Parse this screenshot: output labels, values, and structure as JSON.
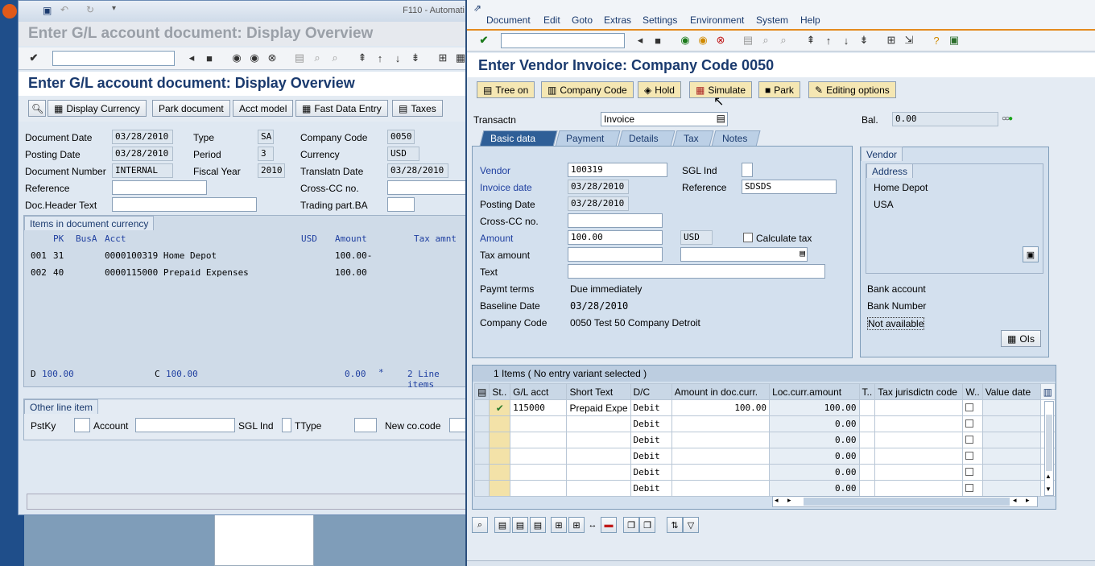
{
  "left_window": {
    "window_title": "F110 - Automati",
    "title": "Enter G/L account document: Display Overview",
    "header_title": "Enter G/L account document: Display Overview",
    "buttons": {
      "display_currency": "Display Currency",
      "park_document": "Park document",
      "acct_model": "Acct model",
      "fast_data_entry": "Fast Data Entry",
      "taxes": "Taxes"
    },
    "fields": {
      "document_date": {
        "label": "Document Date",
        "value": "03/28/2010"
      },
      "posting_date": {
        "label": "Posting Date",
        "value": "03/28/2010"
      },
      "document_number": {
        "label": "Document Number",
        "value": "INTERNAL"
      },
      "reference": {
        "label": "Reference",
        "value": ""
      },
      "doc_header_text": {
        "label": "Doc.Header Text",
        "value": ""
      },
      "type": {
        "label": "Type",
        "value": "SA"
      },
      "period": {
        "label": "Period",
        "value": "3"
      },
      "fiscal_year": {
        "label": "Fiscal Year",
        "value": "2010"
      },
      "company_code": {
        "label": "Company Code",
        "value": "0050"
      },
      "currency": {
        "label": "Currency",
        "value": "USD"
      },
      "translatn_date": {
        "label": "Translatn Date",
        "value": "03/28/2010"
      },
      "cross_cc": {
        "label": "Cross-CC no.",
        "value": ""
      },
      "trading_part": {
        "label": "Trading part.BA",
        "value": ""
      }
    },
    "items": {
      "tab_label": "Items in document currency",
      "headers": {
        "pk": "PK",
        "busa": "BusA",
        "acct": "Acct",
        "usd": "USD",
        "amount": "Amount",
        "tax": "Tax amnt"
      },
      "rows": [
        {
          "line": "001",
          "pk": "31",
          "acct": "0000100319 Home Depot",
          "amount": "100.00-"
        },
        {
          "line": "002",
          "pk": "40",
          "acct": "0000115000 Prepaid Expenses",
          "amount": "100.00"
        }
      ],
      "totals": {
        "d_label": "D",
        "d_value": "100.00",
        "c_label": "C",
        "c_value": "100.00",
        "bal": "0.00",
        "star": "*",
        "lines": "2 Line items"
      }
    },
    "other_line": {
      "tab_label": "Other line item",
      "pstky": "PstKy",
      "account": "Account",
      "sgl_ind": "SGL Ind",
      "ttype": "TType",
      "new_co_code": "New co.code"
    }
  },
  "right_window": {
    "menu": [
      "Document",
      "Edit",
      "Goto",
      "Extras",
      "Settings",
      "Environment",
      "System",
      "Help"
    ],
    "title": "Enter Vendor Invoice: Company Code 0050",
    "buttons": {
      "tree_on": "Tree on",
      "company_code": "Company Code",
      "hold": "Hold",
      "simulate": "Simulate",
      "park": "Park",
      "editing_options": "Editing options"
    },
    "transactn": {
      "label": "Transactn",
      "value": "Invoice"
    },
    "bal": {
      "label": "Bal.",
      "value": "0.00"
    },
    "tabs": [
      "Basic data",
      "Payment",
      "Details",
      "Tax",
      "Notes"
    ],
    "basic": {
      "vendor": {
        "label": "Vendor",
        "value": "100319"
      },
      "invoice_date": {
        "label": "Invoice date",
        "value": "03/28/2010"
      },
      "posting_date": {
        "label": "Posting Date",
        "value": "03/28/2010"
      },
      "cross_cc": {
        "label": "Cross-CC no.",
        "value": ""
      },
      "amount": {
        "label": "Amount",
        "value": "100.00",
        "currency": "USD"
      },
      "calculate_tax": "Calculate tax",
      "tax_amount": {
        "label": "Tax amount",
        "value": ""
      },
      "text": {
        "label": "Text",
        "value": ""
      },
      "paymt_terms": {
        "label": "Paymt terms",
        "value": "Due immediately"
      },
      "baseline_date": {
        "label": "Baseline Date",
        "value": "03/28/2010"
      },
      "company_code": {
        "label": "Company Code",
        "value": "0050 Test 50 Company Detroit"
      },
      "sgl_ind": {
        "label": "SGL Ind",
        "value": ""
      },
      "reference": {
        "label": "Reference",
        "value": "SDSDS"
      }
    },
    "vendor_panel": {
      "title": "Vendor",
      "address_title": "Address",
      "name": "Home Depot",
      "country": "USA",
      "bank_account": "Bank account",
      "bank_number": "Bank Number",
      "not_available": "Not available",
      "ois": "OIs"
    },
    "grid": {
      "title": "1 Items ( No entry variant selected )",
      "headers": [
        "St..",
        "G/L acct",
        "Short Text",
        "D/C",
        "Amount in doc.curr.",
        "Loc.curr.amount",
        "T..",
        "Tax jurisdictn code",
        "W..",
        "Value date"
      ],
      "rows": [
        {
          "gl": "115000",
          "short": "Prepaid Expe",
          "dc": "Debit",
          "amt": "100.00",
          "loc": "100.00"
        },
        {
          "gl": "",
          "short": "",
          "dc": "Debit",
          "amt": "",
          "loc": "0.00"
        },
        {
          "gl": "",
          "short": "",
          "dc": "Debit",
          "amt": "",
          "loc": "0.00"
        },
        {
          "gl": "",
          "short": "",
          "dc": "Debit",
          "amt": "",
          "loc": "0.00"
        },
        {
          "gl": "",
          "short": "",
          "dc": "Debit",
          "amt": "",
          "loc": "0.00"
        },
        {
          "gl": "",
          "short": "",
          "dc": "Debit",
          "amt": "",
          "loc": "0.00"
        }
      ]
    }
  },
  "colors": {
    "accent": "#e48a1e",
    "title_blue": "#1a3a6e",
    "active_tab": "#2f5f97"
  }
}
